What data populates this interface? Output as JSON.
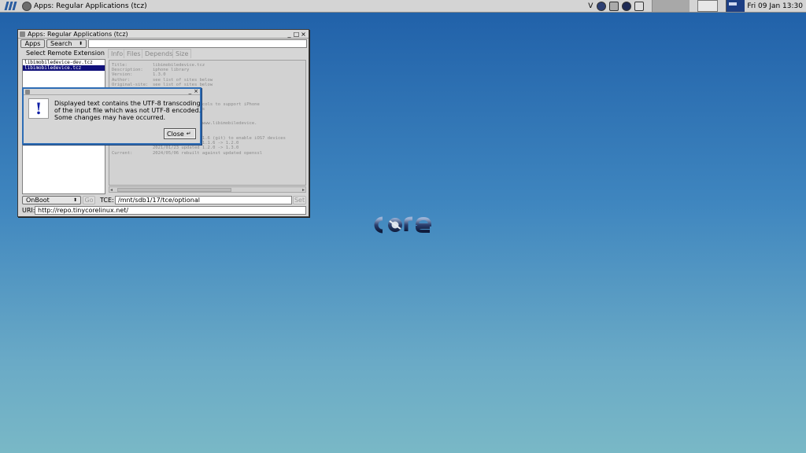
{
  "taskbar": {
    "active_window_title": "Apps: Regular Applications (tcz)",
    "indicator_letter": "V",
    "clock": "Fri 09 Jan 13:30",
    "tray_icons": [
      "network-icon",
      "pen-icon",
      "info-icon",
      "terminal-icon"
    ]
  },
  "app_window": {
    "title": "Apps: Regular Applications (tcz)",
    "controls": {
      "minimize": "_",
      "maximize": "□",
      "close": "×"
    },
    "apps_button": "Apps",
    "search_dropdown": "Search",
    "search_value": "",
    "select_remote_label": "Select Remote Extension",
    "tabs": [
      "Info",
      "Files",
      "Depends",
      "Size"
    ],
    "extensions": [
      {
        "name": "libimobiledevice-dev.tcz",
        "selected": false
      },
      {
        "name": "libimobiledevice.tcz",
        "selected": true
      }
    ],
    "info_lines": [
      {
        "key": "Title:",
        "value": "libimobiledevice.tcz"
      },
      {
        "key": "Description:",
        "value": "iphone library"
      },
      {
        "key": "Version:",
        "value": "1.3.0"
      },
      {
        "key": "Author:",
        "value": "see list of sites below"
      },
      {
        "key": "Original-site:",
        "value": "see list of sites below"
      },
      {
        "key": "",
        "value": "low"
      },
      {
        "key": "",
        "value": ""
      },
      {
        "key": "",
        "value": "phone ipad ipod"
      },
      {
        "key": "",
        "value": "hat talks the protocols to support iPhone"
      },
      {
        "key": "",
        "value": "nd Apple TVN devices"
      },
      {
        "key": "",
        "value": ""
      },
      {
        "key": "",
        "value": "ns:"
      },
      {
        "key": "",
        "value": "0 - GPLv2 - http://www.libimobiledevice."
      },
      {
        "key": "",
        "value": ""
      },
      {
        "key": "",
        "value": "sion"
      },
      {
        "key": "",
        "value": "updated 1.1.5 -> 1.1.6 (git) to enable iOS7 devices"
      },
      {
        "key": "",
        "value": "2016/02/29 updated 1.1.6 -> 1.2.0"
      },
      {
        "key": "",
        "value": "2021/01/23 updated 1.2.0 -> 1.3.0"
      },
      {
        "key": "Current:",
        "value": "2024/05/06 rebuilt against updated openssl"
      }
    ],
    "onboot_select": "OnBoot",
    "go_button": "Go",
    "tce_label": "TCE:",
    "tce_value": "/mnt/sdb1/17/tce/optional",
    "set_button": "Set",
    "uri_label": "URI:",
    "uri_value": "http://repo.tinycorelinux.net/"
  },
  "dialog": {
    "icon_glyph": "!",
    "message_lines": [
      "Displayed text contains the UTF-8 transcoding",
      "of the input file which was not UTF-8 encoded.",
      "Some changes may have occurred."
    ],
    "close_button": "Close",
    "close_shortcut": "↵"
  },
  "colors": {
    "desktop_top": "#1f5fa8",
    "desktop_bottom": "#79b8c6",
    "selection": "#10107a",
    "dialog_border": "#2e6db5"
  }
}
